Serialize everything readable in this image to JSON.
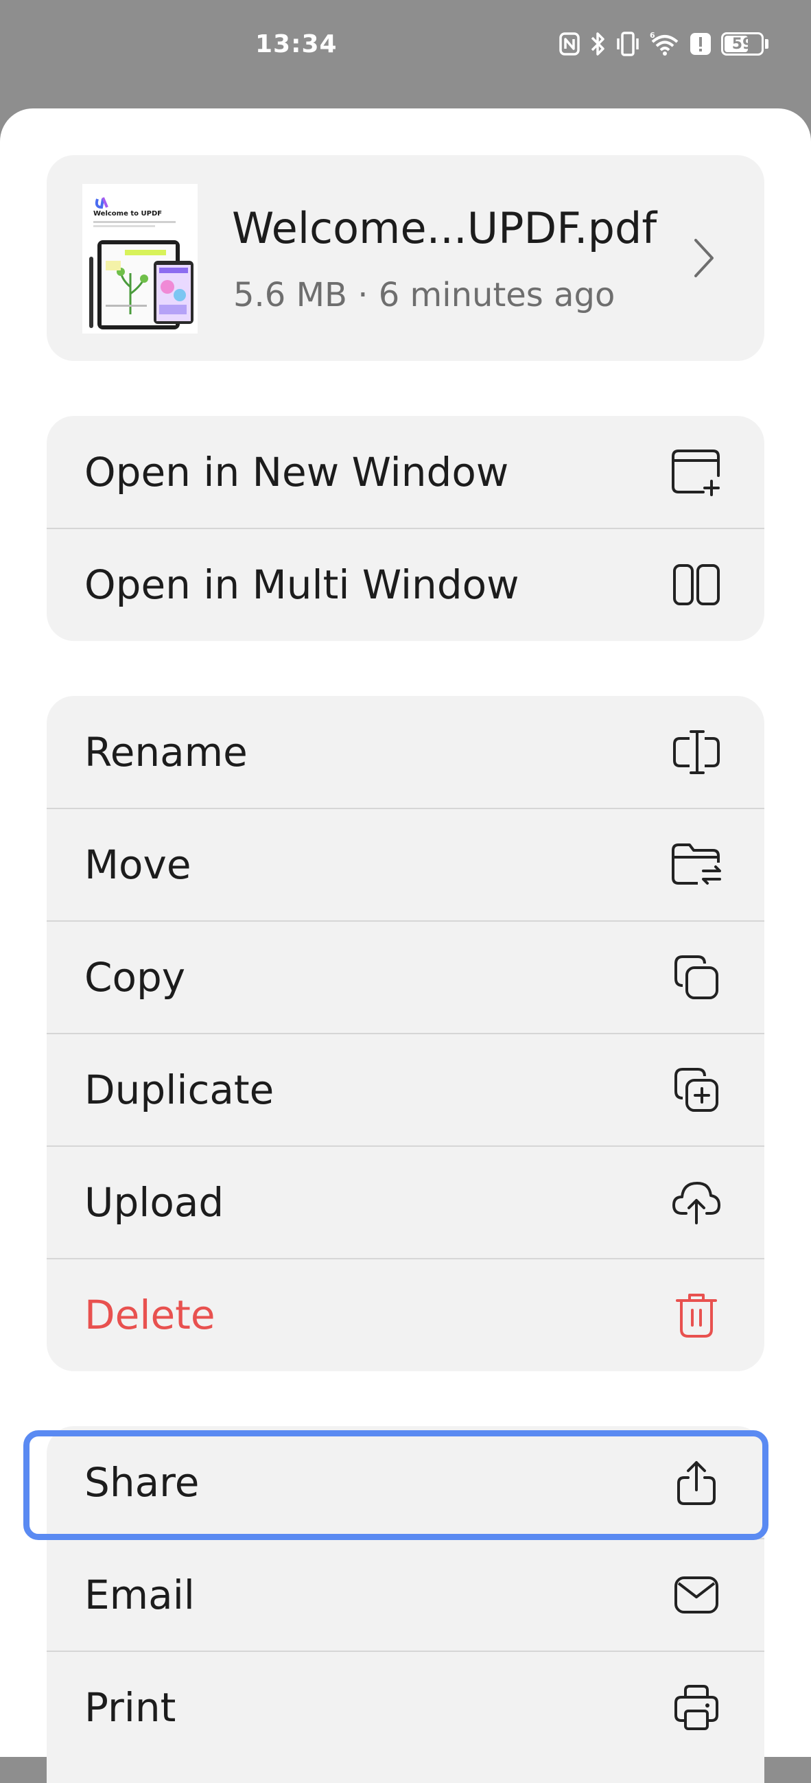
{
  "status_bar": {
    "time": "13:34",
    "battery_level": "59",
    "icons": [
      "nfc-icon",
      "bluetooth-icon",
      "vibrate-icon",
      "wifi-6-icon",
      "alert-icon",
      "battery-icon"
    ]
  },
  "file": {
    "name": "Welcome...UPDF.pdf",
    "meta": "5.6 MB · 6 minutes ago",
    "thumbnail_title": "Welcome to UPDF"
  },
  "groups": {
    "window": [
      {
        "label": "Open in New Window",
        "icon": "new-window-icon"
      },
      {
        "label": "Open in Multi Window",
        "icon": "multi-window-icon"
      }
    ],
    "file_actions": [
      {
        "label": "Rename",
        "icon": "rename-icon"
      },
      {
        "label": "Move",
        "icon": "move-folder-icon"
      },
      {
        "label": "Copy",
        "icon": "copy-icon"
      },
      {
        "label": "Duplicate",
        "icon": "duplicate-icon"
      },
      {
        "label": "Upload",
        "icon": "cloud-upload-icon"
      },
      {
        "label": "Delete",
        "icon": "trash-icon"
      }
    ],
    "share_actions": [
      {
        "label": "Share",
        "icon": "share-icon"
      },
      {
        "label": "Email",
        "icon": "mail-icon"
      },
      {
        "label": "Print",
        "icon": "printer-icon"
      }
    ]
  },
  "colors": {
    "danger": "#e8514f",
    "highlight": "#5a8af2",
    "card_bg": "#f2f2f2",
    "scrim": "#8e8e8e"
  }
}
